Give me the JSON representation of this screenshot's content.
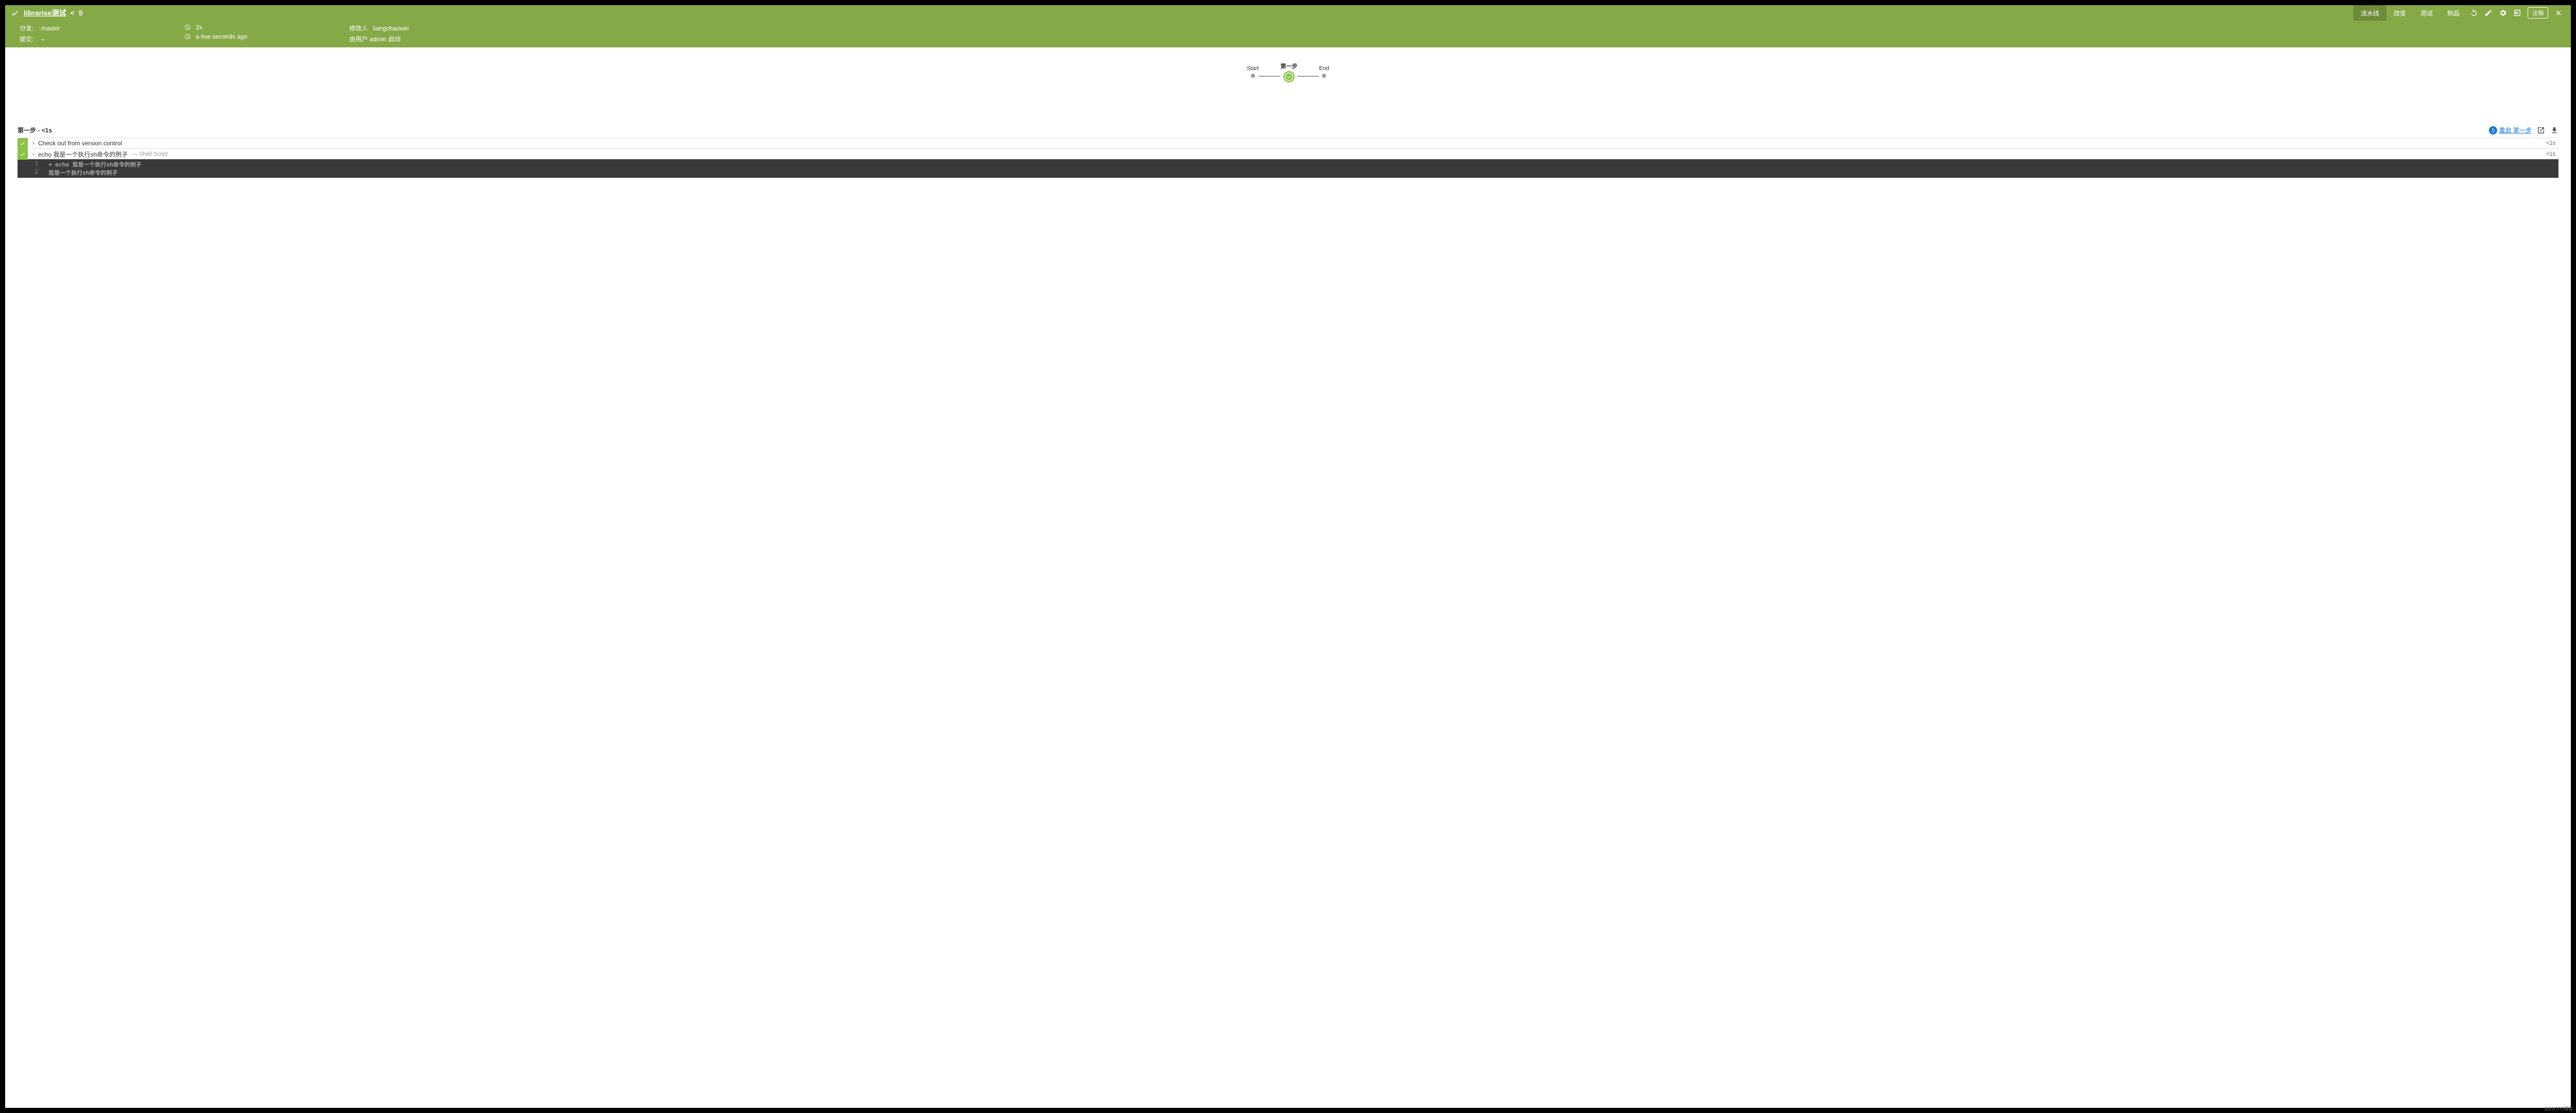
{
  "header": {
    "title": "librarise测试",
    "run_number": "5",
    "tabs": [
      {
        "label": "流水线",
        "active": true
      },
      {
        "label": "改变",
        "active": false
      },
      {
        "label": "测试",
        "active": false
      },
      {
        "label": "制品",
        "active": false
      }
    ],
    "logout_label": "注销"
  },
  "info": {
    "branch_label": "分支:",
    "branch_value": "master",
    "commit_label": "提交:",
    "commit_value": "–",
    "duration_value": "2s",
    "time_value": "a few seconds ago",
    "modifier_label": "修改人",
    "modifier_value": "liangchaowei",
    "started_by": "由用户 admin 启动"
  },
  "pipeline": {
    "stages": [
      {
        "label": "Start",
        "type": "dot"
      },
      {
        "label": "第一步",
        "type": "check"
      },
      {
        "label": "End",
        "type": "dot"
      }
    ]
  },
  "steps": {
    "title": "第一步 - <1s",
    "restart_label": "重启 第一步",
    "rows": [
      {
        "name": "Check out from version control",
        "type": "",
        "time": "<1s",
        "expanded": false
      },
      {
        "name": "echo 我是一个执行sh命令的例子",
        "type": "— Shell Script",
        "time": "<1s",
        "expanded": true
      }
    ],
    "console": [
      {
        "num": "1",
        "text": "+ echo 我是一个执行sh命令的例子"
      },
      {
        "num": "2",
        "text": "我是一个执行sh命令的例子"
      }
    ]
  },
  "watermark": "@51CTO博客"
}
